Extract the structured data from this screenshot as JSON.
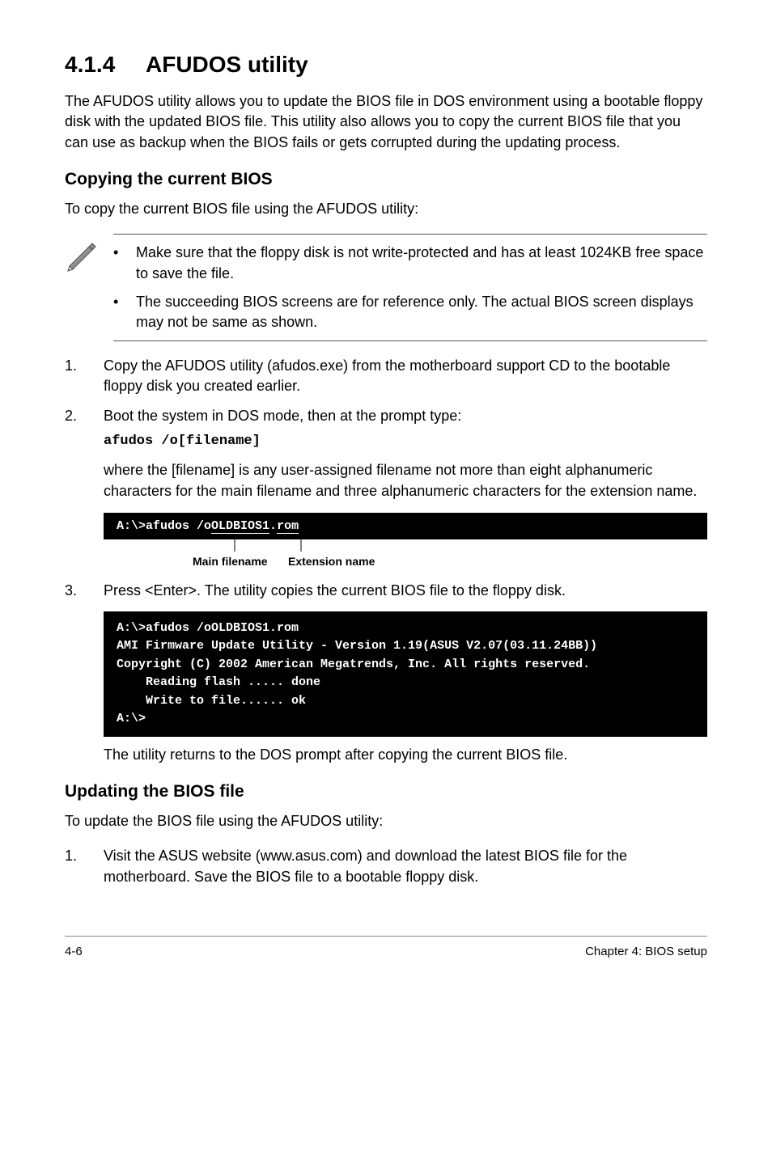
{
  "section": {
    "number": "4.1.4",
    "title": "AFUDOS utility"
  },
  "intro": "The AFUDOS utility allows you to update the BIOS file in DOS environment using a bootable floppy disk with the updated BIOS file. This utility also allows you to copy the current BIOS file that you can use as backup when the BIOS fails or gets corrupted during the updating process.",
  "copying": {
    "heading": "Copying the current BIOS",
    "lead": "To copy the current BIOS file using the AFUDOS utility:",
    "notes": [
      "Make sure that the floppy disk is not write-protected and has at least 1024KB free space to save the file.",
      "The succeeding BIOS screens are for reference only. The actual BIOS screen displays may not be same as shown."
    ],
    "steps": {
      "s1": {
        "num": "1.",
        "text": "Copy the AFUDOS utility (afudos.exe) from the motherboard support CD to the bootable floppy disk you created earlier."
      },
      "s2": {
        "num": "2.",
        "text": "Boot the system in DOS mode, then at the prompt type:",
        "code": "afudos /o[filename]",
        "after": "where the [filename] is any user-assigned filename not more than eight alphanumeric characters  for the main filename and three alphanumeric characters for the extension name."
      },
      "s3": {
        "num": "3.",
        "text": "Press <Enter>. The utility copies the current BIOS file to the floppy disk."
      }
    },
    "filename_example": {
      "raw": "A:\\>afudos /oOLDBIOS1.rom",
      "main_label": "Main filename",
      "ext_label": "Extension name"
    },
    "codeblock2": "A:\\>afudos /oOLDBIOS1.rom\nAMI Firmware Update Utility - Version 1.19(ASUS V2.07(03.11.24BB))\nCopyright (C) 2002 American Megatrends, Inc. All rights reserved.\n    Reading flash ..... done\n    Write to file...... ok\nA:\\>",
    "after_code": "The utility returns to the DOS prompt after copying the current BIOS file."
  },
  "updating": {
    "heading": "Updating the BIOS file",
    "lead": "To update the BIOS file using the AFUDOS utility:",
    "steps": {
      "s1": {
        "num": "1.",
        "text": "Visit the ASUS website (www.asus.com) and download the latest BIOS file for the motherboard. Save the BIOS file to a bootable floppy disk."
      }
    }
  },
  "footer": {
    "left": "4-6",
    "right": "Chapter 4: BIOS setup"
  }
}
